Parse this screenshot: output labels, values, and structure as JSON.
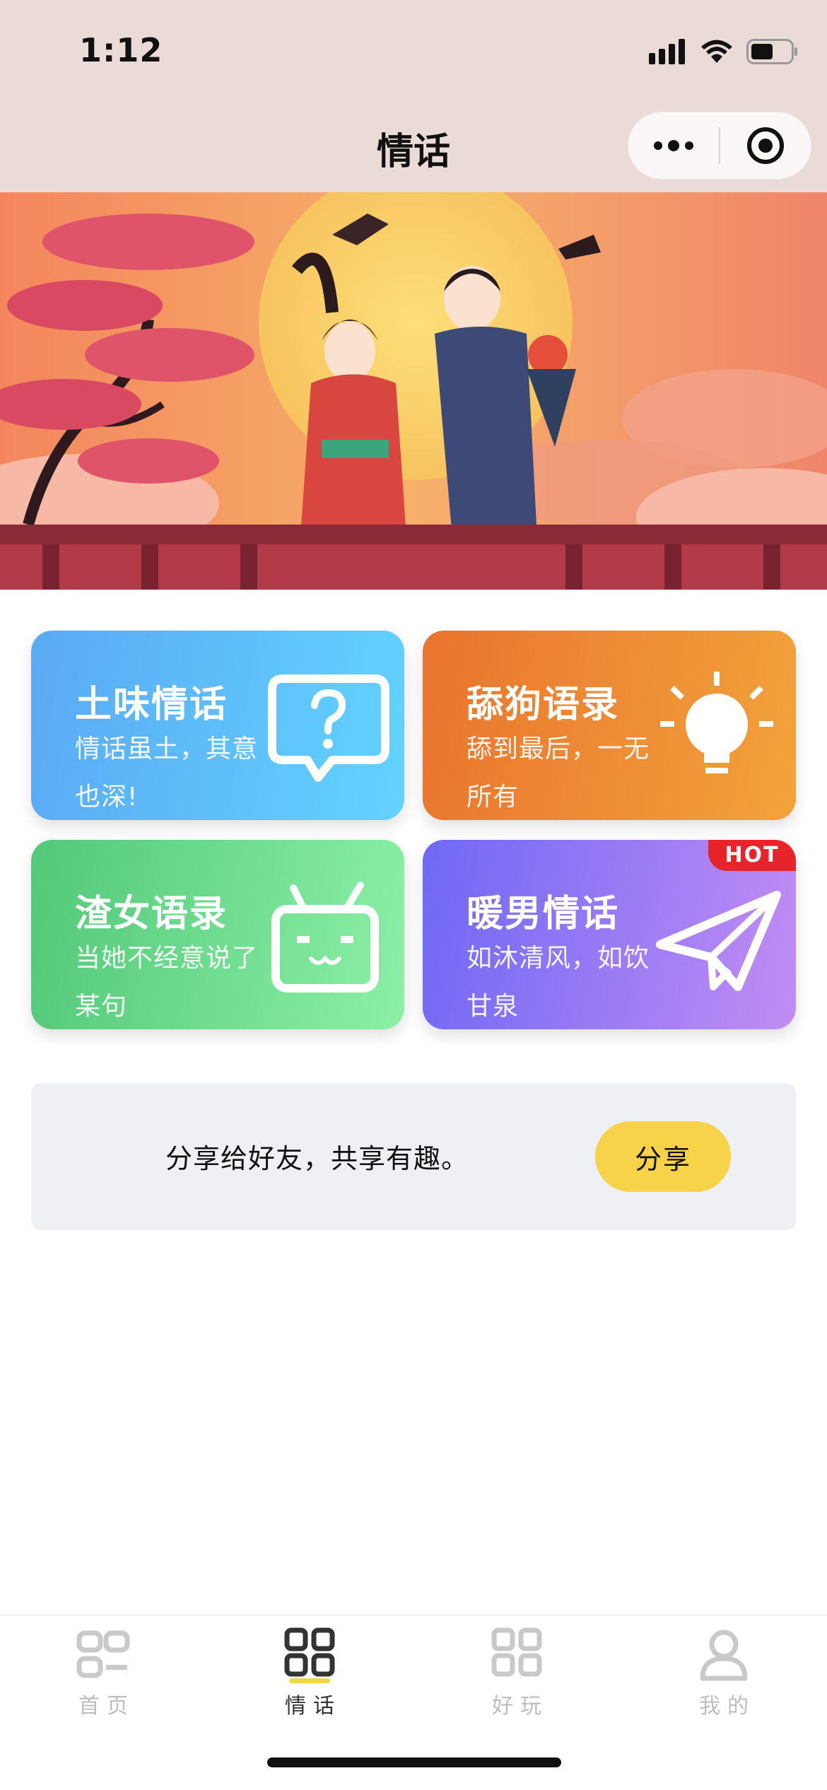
{
  "status_bar": {
    "time": "1:12",
    "icons": [
      "cellular-icon",
      "wifi-icon",
      "battery-icon"
    ]
  },
  "nav": {
    "title": "情话",
    "capsule_icons": [
      "more-icon",
      "close-target-icon"
    ]
  },
  "banner": {
    "scene": "ancient-chinese-couple-illustration"
  },
  "cards": [
    {
      "title": "土味情话",
      "desc": "情话虽土，其意也深!",
      "icon": "question-bubble-icon",
      "color": "#5aa9f4"
    },
    {
      "title": "舔狗语录",
      "desc": "舔到最后，一无所有",
      "icon": "lightbulb-icon",
      "color": "#ec8633"
    },
    {
      "title": "渣女语录",
      "desc": "当她不经意说了某句",
      "icon": "tv-face-icon",
      "color": "#52c878"
    },
    {
      "title": "暖男情话",
      "desc": "如沐清风，如饮甘泉",
      "icon": "paper-plane-icon",
      "color": "#8a74f5",
      "badge": "HOT"
    }
  ],
  "share": {
    "text": "分享给好友，共享有趣。",
    "button": "分享",
    "button_color": "#f7d34a"
  },
  "tabbar": {
    "items": [
      {
        "label": "首页",
        "icon": "home-link-icon",
        "active": false
      },
      {
        "label": "情话",
        "icon": "grid-icon",
        "active": true
      },
      {
        "label": "好玩",
        "icon": "grid-icon",
        "active": false
      },
      {
        "label": "我的",
        "icon": "user-icon",
        "active": false
      }
    ],
    "accent": "#f2d648"
  }
}
